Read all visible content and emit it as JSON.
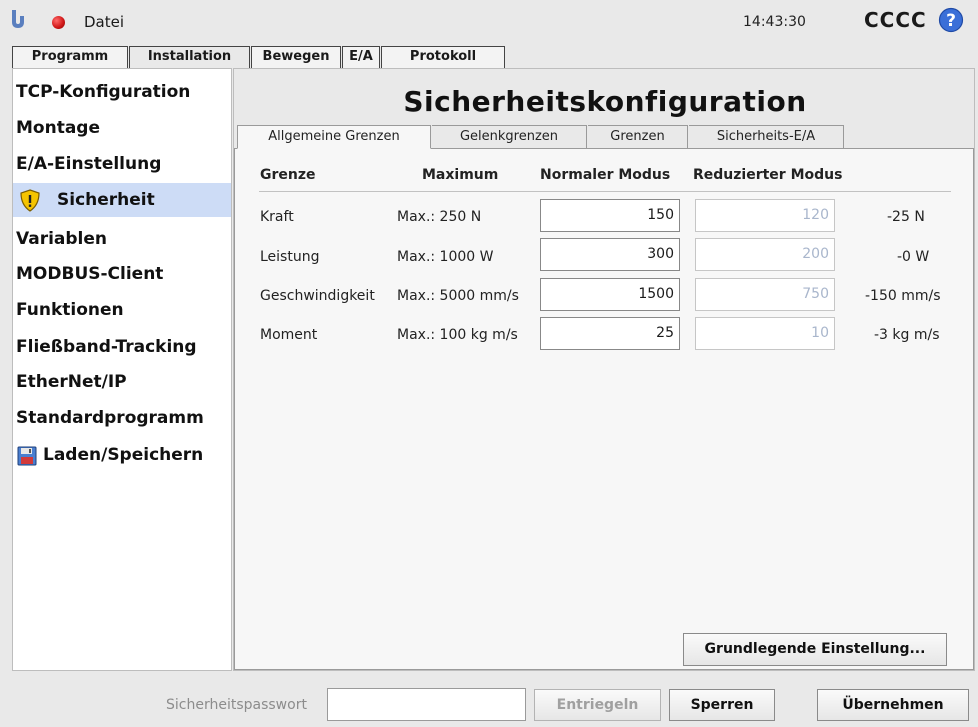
{
  "topbar": {
    "menu_label": "Datei",
    "clock": "14:43:30",
    "robot_name": "CCCC"
  },
  "main_tabs": [
    "Programm",
    "Installation",
    "Bewegen",
    "E/A",
    "Protokoll"
  ],
  "sidebar": {
    "items": [
      {
        "label": "TCP-Konfiguration"
      },
      {
        "label": "Montage"
      },
      {
        "label": "E/A-Einstellung"
      },
      {
        "label": "Sicherheit",
        "active": true,
        "icon": "shield-warning-icon"
      },
      {
        "label": "Variablen"
      },
      {
        "label": "MODBUS-Client"
      },
      {
        "label": "Funktionen"
      },
      {
        "label": "Fließband-Tracking"
      },
      {
        "label": "EtherNet/IP"
      },
      {
        "label": "Standardprogramm"
      },
      {
        "label": "Laden/Speichern",
        "icon": "floppy-disk-icon"
      }
    ]
  },
  "content": {
    "title": "Sicherheitskonfiguration",
    "subtabs": [
      "Allgemeine Grenzen",
      "Gelenkgrenzen",
      "Grenzen",
      "Sicherheits-E/A"
    ],
    "table": {
      "headers": [
        "Grenze",
        "Maximum",
        "Normaler Modus",
        "Reduzierter Modus"
      ],
      "rows": [
        {
          "name": "Kraft",
          "max": "Max.: 250 N",
          "normal": "150",
          "reduced": "120",
          "delta": "-25 N"
        },
        {
          "name": "Leistung",
          "max": "Max.: 1000 W",
          "normal": "300",
          "reduced": "200",
          "delta": "-0 W"
        },
        {
          "name": "Geschwindigkeit",
          "max": "Max.: 5000 mm/s",
          "normal": "1500",
          "reduced": "750",
          "delta": "-150 mm/s"
        },
        {
          "name": "Moment",
          "max": "Max.: 100 kg m/s",
          "normal": "25",
          "reduced": "10",
          "delta": "-3 kg m/s"
        }
      ]
    },
    "basic_settings_button": "Grundlegende Einstellung..."
  },
  "bottom": {
    "password_label": "Sicherheitspasswort",
    "password_value": "",
    "unlock_button": "Entriegeln",
    "lock_button": "Sperren",
    "apply_button": "Übernehmen"
  },
  "colors": {
    "sidebar_active": "#cddcf6",
    "status_dot": "#d21a1a",
    "help_icon": "#3a6fd8",
    "shield_icon": "#f5c400"
  }
}
